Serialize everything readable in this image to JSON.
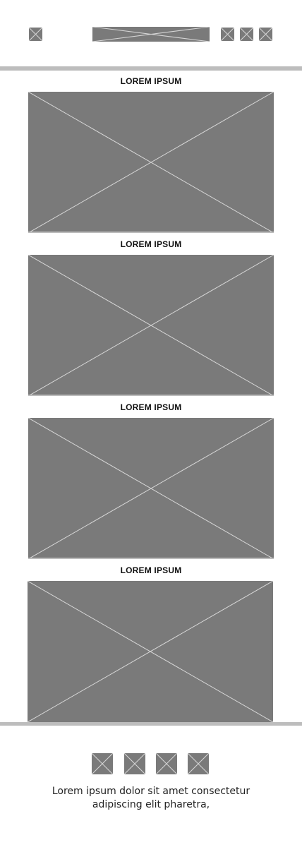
{
  "header": {
    "menu_icon": "placeholder-icon",
    "logo": "placeholder-image",
    "actions": [
      "placeholder-icon",
      "placeholder-icon",
      "placeholder-icon"
    ]
  },
  "sections": [
    {
      "title": "LOREM IPSUM",
      "image": "placeholder-image"
    },
    {
      "title": "LOREM IPSUM",
      "image": "placeholder-image"
    },
    {
      "title": "LOREM IPSUM",
      "image": "placeholder-image"
    },
    {
      "title": "LOREM IPSUM",
      "image": "placeholder-image"
    }
  ],
  "footer": {
    "social_icons": [
      "placeholder-icon",
      "placeholder-icon",
      "placeholder-icon",
      "placeholder-icon"
    ],
    "text_line1": "Lorem ipsum dolor sit amet consectetur",
    "text_line2": "adipiscing elit pharetra,"
  },
  "colors": {
    "placeholder_fill": "#7a7a7a",
    "placeholder_lines": "#d6d6d6",
    "rule": "#bdbdbd",
    "background": "#ffffff"
  }
}
